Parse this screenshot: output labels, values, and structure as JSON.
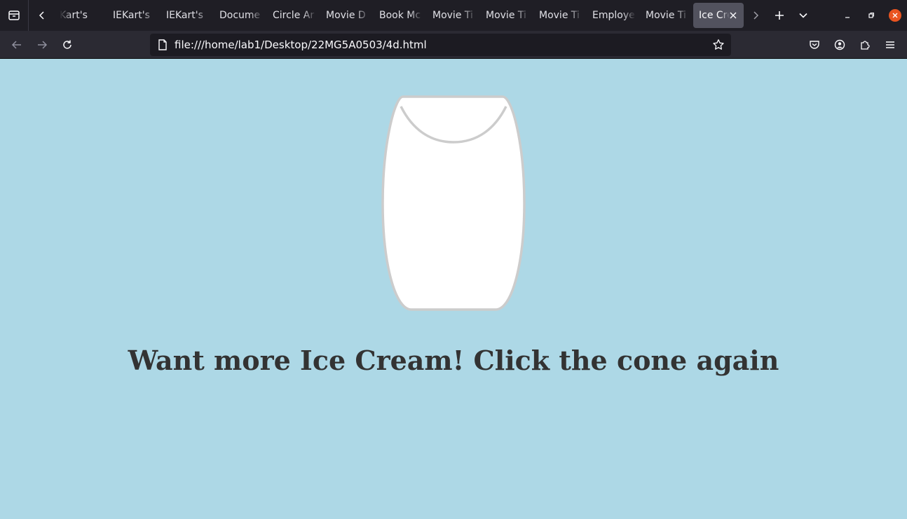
{
  "browser": {
    "tabs": [
      {
        "label": "Kart's"
      },
      {
        "label": "IEKart's"
      },
      {
        "label": "IEKart's"
      },
      {
        "label": "Docume"
      },
      {
        "label": "Circle Ar"
      },
      {
        "label": "Movie D"
      },
      {
        "label": "Book Mc"
      },
      {
        "label": "Movie Ti"
      },
      {
        "label": "Movie Ti"
      },
      {
        "label": "Movie Ti"
      },
      {
        "label": "Employe"
      },
      {
        "label": "Movie Ti"
      },
      {
        "label": "Ice Cre",
        "active": true
      }
    ],
    "url": "file:///home/lab1/Desktop/22MG5A0503/4d.html"
  },
  "page": {
    "message": "Want more Ice Cream! Click the cone again"
  },
  "colors": {
    "page_background": "#add8e6",
    "cone_fill": "#ffffff",
    "cone_stroke": "#cccccc",
    "text": "#333333"
  }
}
